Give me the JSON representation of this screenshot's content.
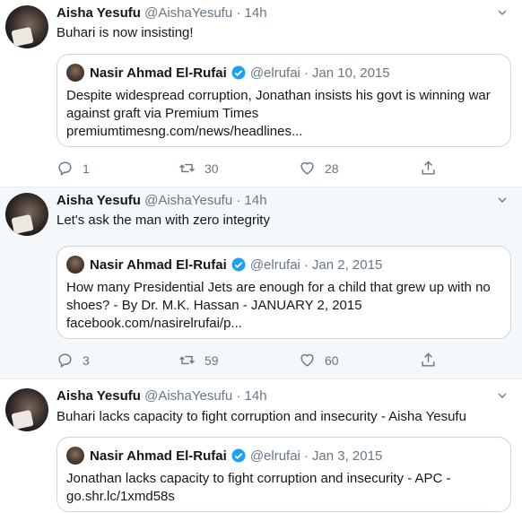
{
  "tweets": [
    {
      "name": "Aisha Yesufu",
      "handle": "@AishaYesufu",
      "dot": "·",
      "time": "14h",
      "text": "Buhari is now insisting!",
      "quote": {
        "name": "Nasir Ahmad El-Rufai",
        "handle": "@elrufai",
        "dot": "·",
        "date": "Jan 10, 2015",
        "lines": [
          "Despite widespread corruption, Jonathan insists his govt is winning war",
          "against graft via Premium Times",
          "premiumtimesng.com/news/headlines..."
        ]
      },
      "replies": "1",
      "retweets": "30",
      "likes": "28"
    },
    {
      "name": "Aisha Yesufu",
      "handle": "@AishaYesufu",
      "dot": "·",
      "time": "14h",
      "text": "Let's ask the man with zero integrity",
      "quote": {
        "name": "Nasir Ahmad El-Rufai",
        "handle": "@elrufai",
        "dot": "·",
        "date": "Jan 2, 2015",
        "lines": [
          "How many Presidential Jets are enough for a child that grew up with no",
          "shoes? - By Dr. M.K. Hassan - JANUARY 2, 2015",
          "facebook.com/nasirelrufai/p..."
        ]
      },
      "replies": "3",
      "retweets": "59",
      "likes": "60"
    },
    {
      "name": "Aisha Yesufu",
      "handle": "@AishaYesufu",
      "dot": "·",
      "time": "14h",
      "text": "Buhari lacks capacity to fight corruption and insecurity - Aisha Yesufu",
      "quote": {
        "name": "Nasir Ahmad El-Rufai",
        "handle": "@elrufai",
        "dot": "·",
        "date": "Jan 3, 2015",
        "lines": [
          "Jonathan lacks capacity to fight corruption and insecurity - APC -",
          "go.shr.lc/1xmd58s"
        ]
      }
    }
  ],
  "colors": {
    "muted": "#657786",
    "verified": "#1da1f2",
    "border": "#e6ecf0"
  }
}
